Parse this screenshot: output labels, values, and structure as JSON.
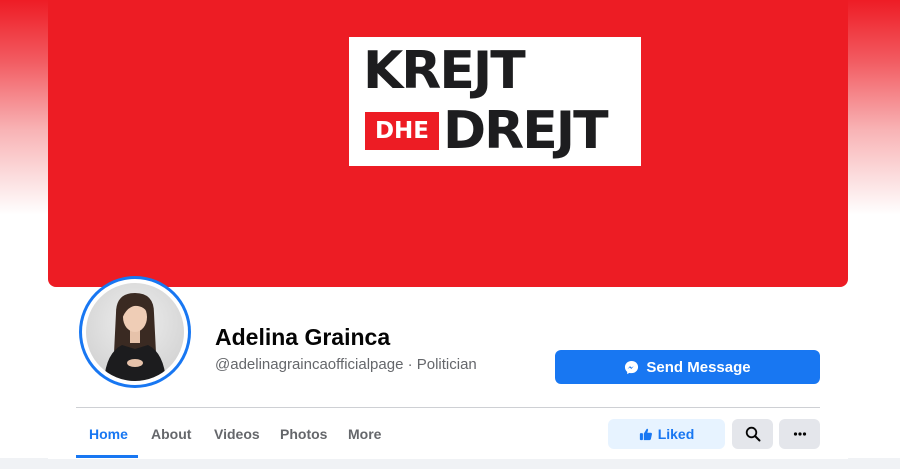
{
  "cover": {
    "logo_line1": "KREJT",
    "logo_dhe": "DHE",
    "logo_line2": "DREJT",
    "accent_color": "#ed1c24"
  },
  "profile": {
    "name": "Adelina Grainca",
    "handle_category": "@adelinagraincaofficialpage · Politician",
    "avatar_ring_color": "#1877f2"
  },
  "actions": {
    "send_message_label": "Send Message",
    "send_message_icon": "messenger-icon",
    "liked_label": "Liked",
    "liked_icon": "thumbs-up-icon",
    "search_icon": "search-icon",
    "more_icon": "more-options-icon"
  },
  "tabs": [
    {
      "label": "Home",
      "active": true
    },
    {
      "label": "About",
      "active": false
    },
    {
      "label": "Videos",
      "active": false
    },
    {
      "label": "Photos",
      "active": false
    },
    {
      "label": "More",
      "active": false
    }
  ],
  "colors": {
    "primary": "#1877f2",
    "liked_bg": "#e7f3ff",
    "secondary_button": "#e4e6eb",
    "muted_text": "#65676b"
  }
}
